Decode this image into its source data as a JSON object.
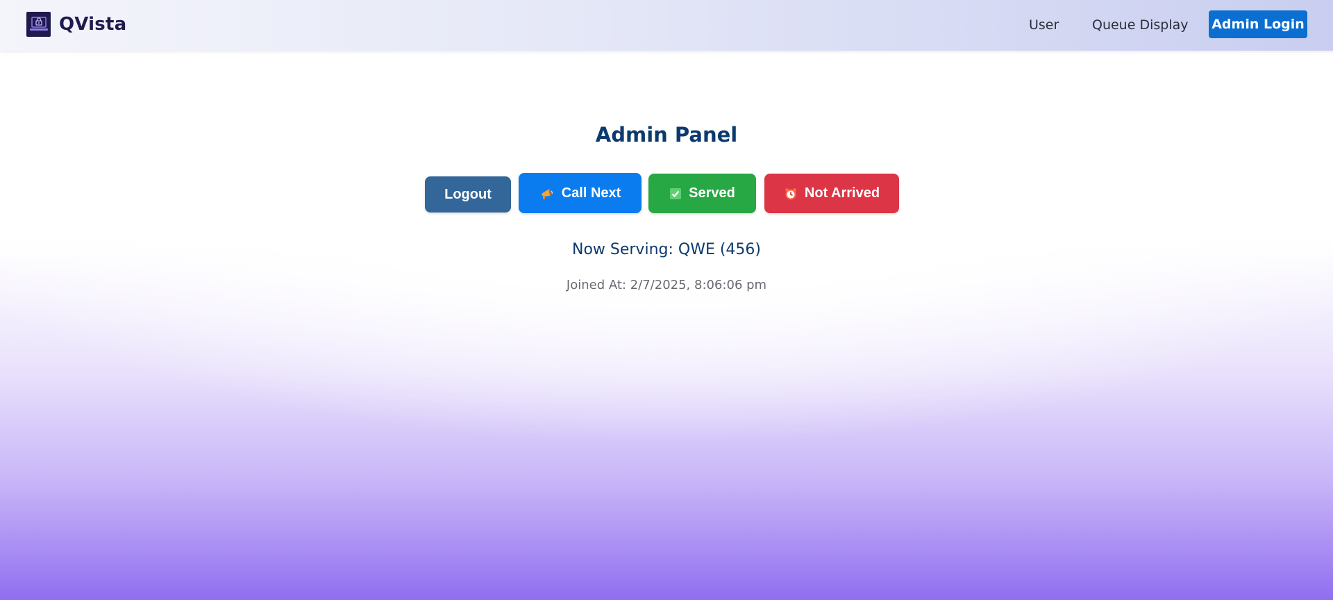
{
  "brand": {
    "name": "QVista",
    "logo_icon": "laptop-lock-icon"
  },
  "nav": {
    "links": [
      "User",
      "Queue Display"
    ],
    "admin_login": "Admin Login",
    "admin_color": "#0a6fd1"
  },
  "panel": {
    "title": "Admin Panel",
    "buttons": {
      "logout": "Logout",
      "call_next": "Call Next",
      "served": "Served",
      "not_arrived": "Not Arrived"
    },
    "button_icons": {
      "call_next": "megaphone-icon",
      "served": "check-box-icon",
      "not_arrived": "alarm-clock-icon"
    },
    "colors": {
      "logout": "#336699",
      "call_next": "#0a7cf0",
      "served": "#28a745",
      "not_arrived": "#dc3545"
    },
    "now_serving": "Now Serving: QWE (456)",
    "joined_at": "Joined At: 2/7/2025, 8:06:06 pm"
  }
}
